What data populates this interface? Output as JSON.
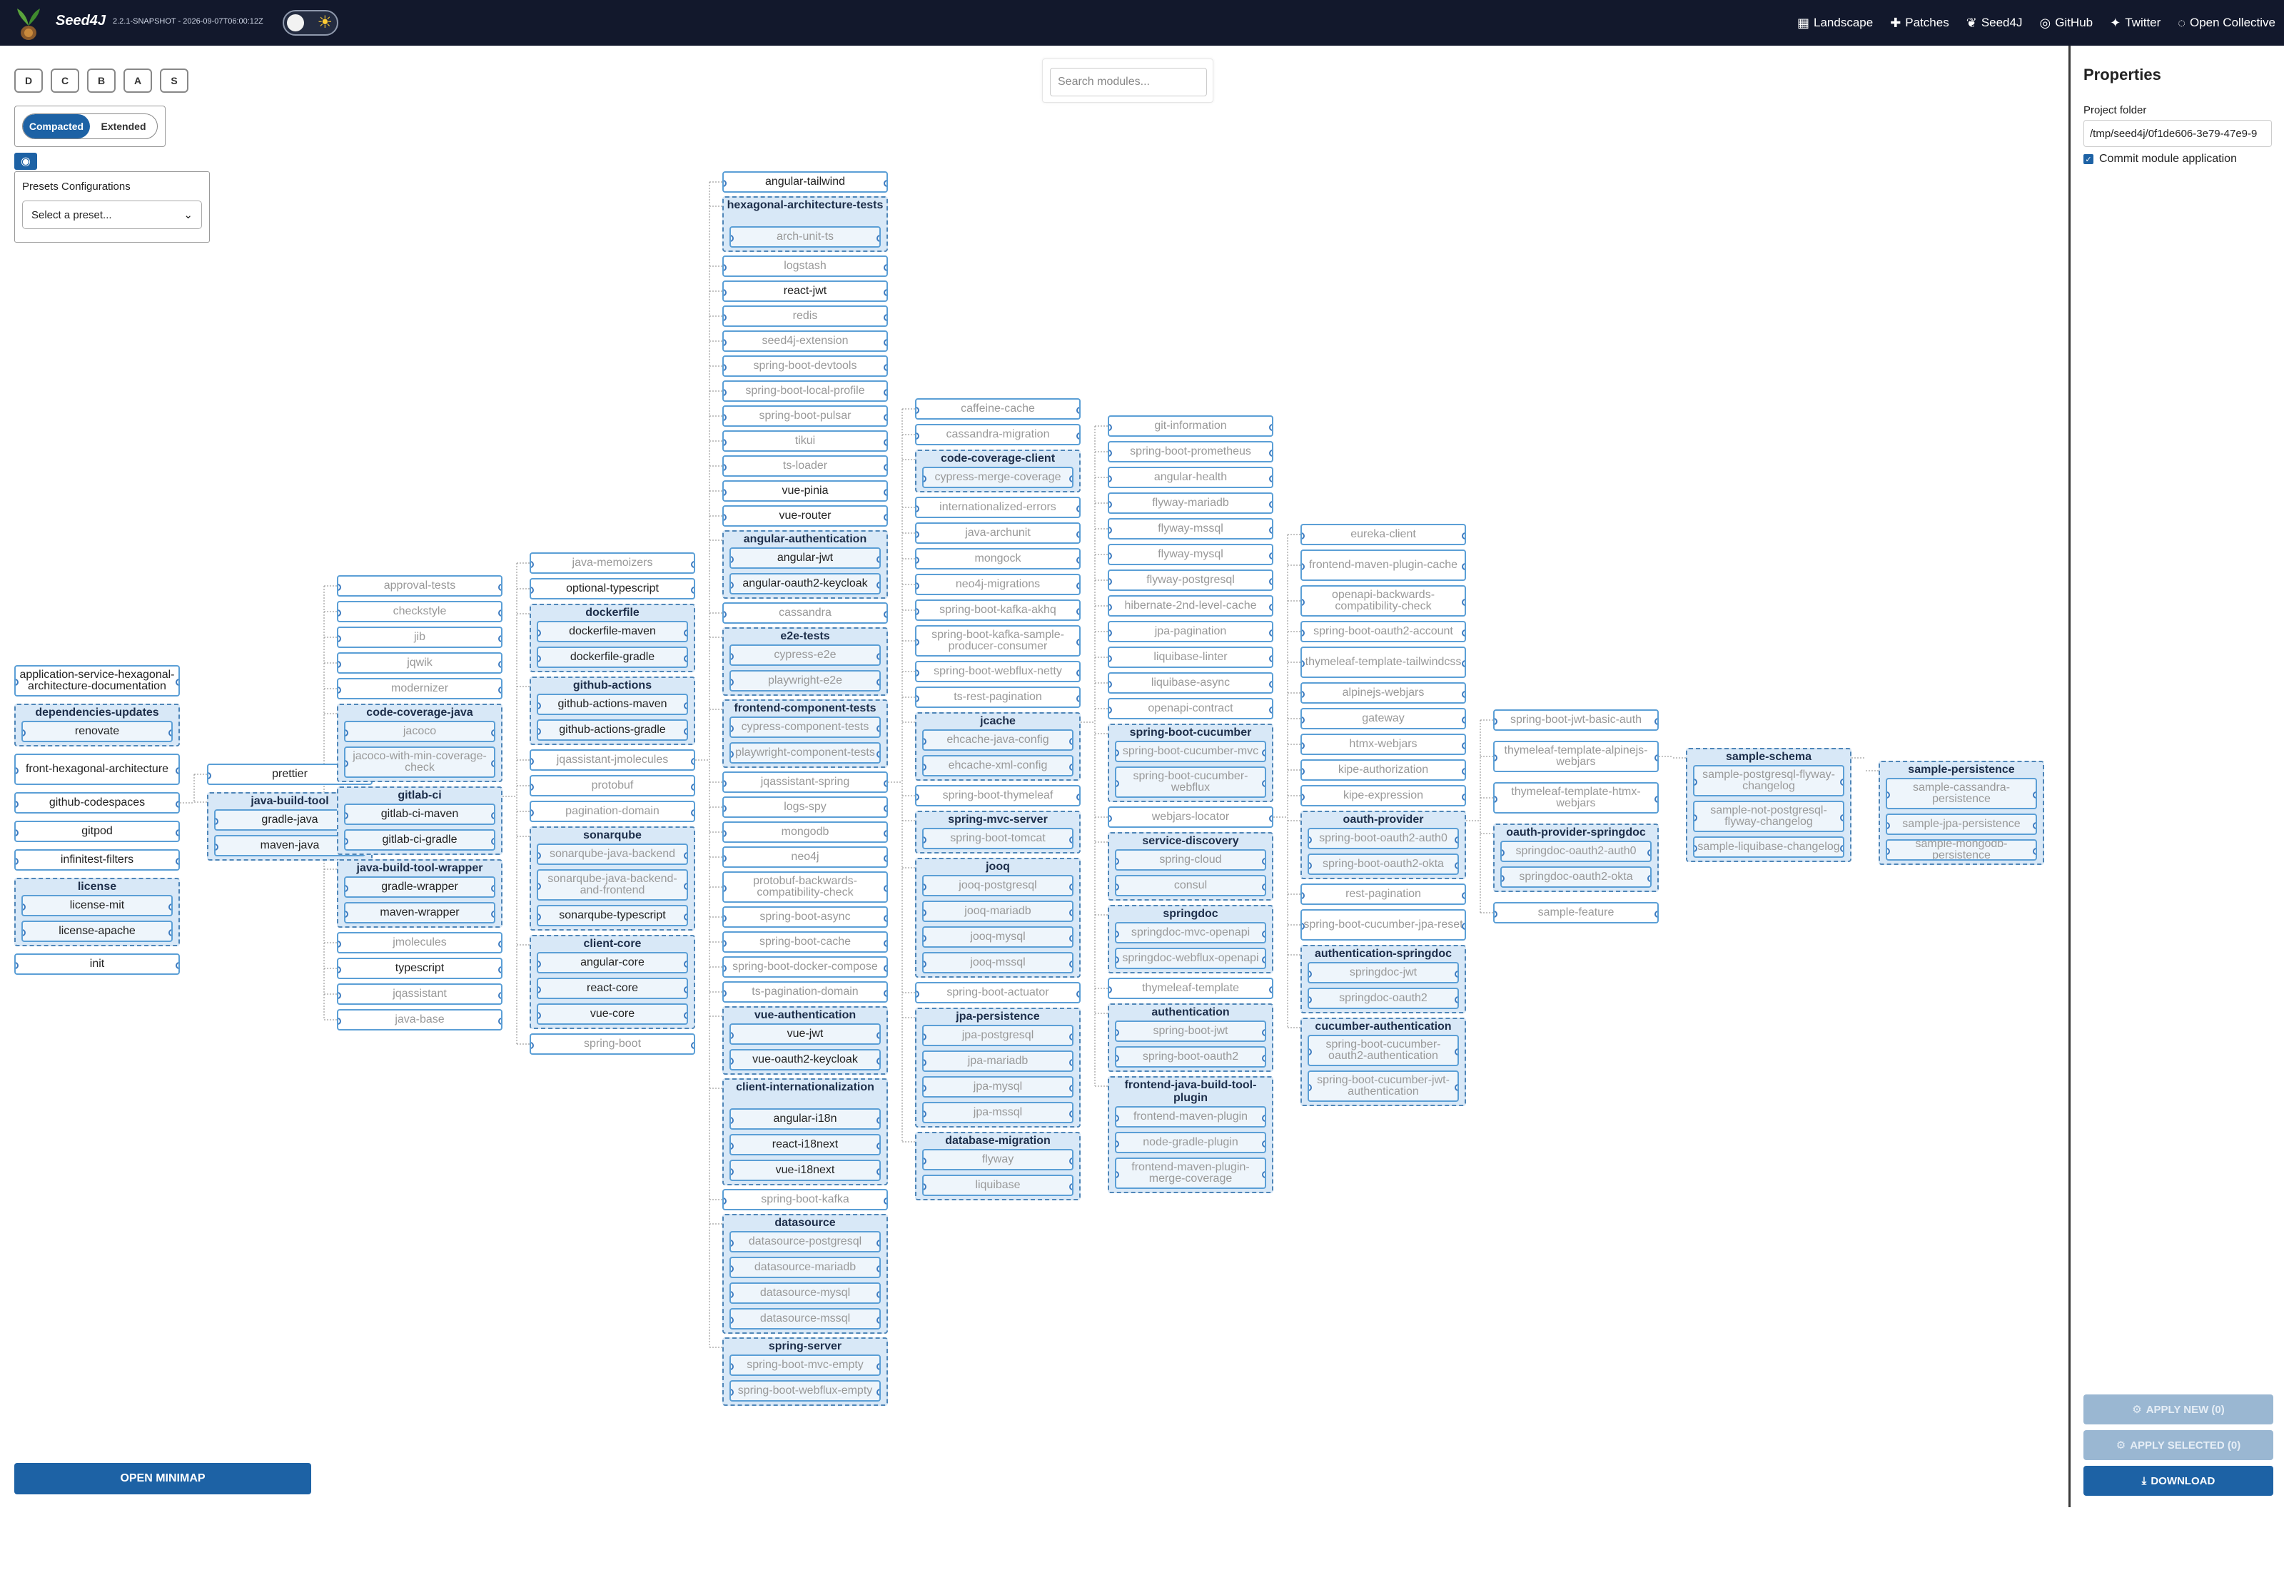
{
  "app": {
    "brand": "Seed4J",
    "version": "2.2.1-SNAPSHOT - 2026-09-07T06:00:12Z"
  },
  "nav": [
    {
      "label": "Landscape",
      "icon": "map-icon"
    },
    {
      "label": "Patches",
      "icon": "puzzle-icon"
    },
    {
      "label": "Seed4J",
      "icon": "seed-icon"
    },
    {
      "label": "GitHub",
      "icon": "github-icon"
    },
    {
      "label": "Twitter",
      "icon": "twitter-icon"
    },
    {
      "label": "Open Collective",
      "icon": "opencollective-icon"
    }
  ],
  "toolbar": {
    "letters": [
      "D",
      "C",
      "B",
      "A",
      "S"
    ],
    "mode_compacted": "Compacted",
    "mode_extended": "Extended",
    "presets_title": "Presets Configurations",
    "preset_placeholder": "Select a preset...",
    "search_placeholder": "Search modules...",
    "minimap": "OPEN MINIMAP"
  },
  "properties": {
    "title": "Properties",
    "folder_label": "Project folder",
    "folder_value": "/tmp/seed4j/0f1de606-3e79-47e9-9",
    "commit_label": "Commit module application",
    "apply_new": "APPLY NEW (0)",
    "apply_selected": "APPLY SELECTED (0)",
    "download": "DOWNLOAD"
  },
  "graph": {
    "columns": [
      {
        "items": [
          {
            "label": "application-service-hexagonal-architecture-documentation",
            "sel": true
          },
          {
            "group": "dependencies-updates",
            "items": [
              {
                "label": "renovate",
                "sel": true
              }
            ]
          },
          {
            "label": "front-hexagonal-architecture",
            "sel": true
          },
          {
            "label": "github-codespaces",
            "sel": true
          },
          {
            "label": "gitpod",
            "sel": true
          },
          {
            "label": "infinitest-filters",
            "sel": true
          },
          {
            "group": "license",
            "items": [
              {
                "label": "license-mit",
                "sel": true
              },
              {
                "label": "license-apache",
                "sel": true
              }
            ]
          },
          {
            "label": "init",
            "sel": true
          }
        ]
      },
      {
        "items": [
          {
            "label": "prettier",
            "sel": true
          },
          {
            "group": "java-build-tool",
            "items": [
              {
                "label": "gradle-java",
                "sel": true
              },
              {
                "label": "maven-java",
                "sel": true
              }
            ]
          }
        ]
      },
      {
        "items": [
          {
            "label": "approval-tests"
          },
          {
            "label": "checkstyle"
          },
          {
            "label": "jib"
          },
          {
            "label": "jqwik"
          },
          {
            "label": "modernizer"
          },
          {
            "group": "code-coverage-java",
            "items": [
              {
                "label": "jacoco"
              },
              {
                "label": "jacoco-with-min-coverage-check"
              }
            ]
          },
          {
            "group": "gitlab-ci",
            "items": [
              {
                "label": "gitlab-ci-maven",
                "sel": true
              },
              {
                "label": "gitlab-ci-gradle",
                "sel": true
              }
            ]
          },
          {
            "group": "java-build-tool-wrapper",
            "items": [
              {
                "label": "gradle-wrapper",
                "sel": true
              },
              {
                "label": "maven-wrapper",
                "sel": true
              }
            ]
          },
          {
            "label": "jmolecules"
          },
          {
            "label": "typescript",
            "sel": true
          },
          {
            "label": "jqassistant"
          },
          {
            "label": "java-base"
          }
        ]
      },
      {
        "items": [
          {
            "label": "java-memoizers"
          },
          {
            "label": "optional-typescript",
            "sel": true
          },
          {
            "group": "dockerfile",
            "items": [
              {
                "label": "dockerfile-maven",
                "sel": true
              },
              {
                "label": "dockerfile-gradle",
                "sel": true
              }
            ]
          },
          {
            "group": "github-actions",
            "items": [
              {
                "label": "github-actions-maven",
                "sel": true
              },
              {
                "label": "github-actions-gradle",
                "sel": true
              }
            ]
          },
          {
            "label": "jqassistant-jmolecules"
          },
          {
            "label": "protobuf"
          },
          {
            "label": "pagination-domain"
          },
          {
            "group": "sonarqube",
            "items": [
              {
                "label": "sonarqube-java-backend"
              },
              {
                "label": "sonarqube-java-backend-and-frontend"
              },
              {
                "label": "sonarqube-typescript",
                "sel": true
              }
            ]
          },
          {
            "group": "client-core",
            "items": [
              {
                "label": "angular-core",
                "sel": true
              },
              {
                "label": "react-core",
                "sel": true
              },
              {
                "label": "vue-core",
                "sel": true
              }
            ]
          },
          {
            "label": "spring-boot"
          }
        ]
      },
      {
        "items": [
          {
            "label": "angular-tailwind",
            "sel": true
          },
          {
            "group": "hexagonal-architecture-tests",
            "items": [
              {
                "label": "arch-unit-ts"
              }
            ]
          },
          {
            "label": "logstash"
          },
          {
            "label": "react-jwt",
            "sel": true
          },
          {
            "label": "redis"
          },
          {
            "label": "seed4j-extension"
          },
          {
            "label": "spring-boot-devtools"
          },
          {
            "label": "spring-boot-local-profile"
          },
          {
            "label": "spring-boot-pulsar"
          },
          {
            "label": "tikui"
          },
          {
            "label": "ts-loader"
          },
          {
            "label": "vue-pinia",
            "sel": true
          },
          {
            "label": "vue-router",
            "sel": true
          },
          {
            "group": "angular-authentication",
            "items": [
              {
                "label": "angular-jwt",
                "sel": true
              },
              {
                "label": "angular-oauth2-keycloak",
                "sel": true
              }
            ]
          },
          {
            "label": "cassandra"
          },
          {
            "group": "e2e-tests",
            "items": [
              {
                "label": "cypress-e2e"
              },
              {
                "label": "playwright-e2e"
              }
            ]
          },
          {
            "group": "frontend-component-tests",
            "items": [
              {
                "label": "cypress-component-tests"
              },
              {
                "label": "playwright-component-tests"
              }
            ]
          },
          {
            "label": "jqassistant-spring"
          },
          {
            "label": "logs-spy"
          },
          {
            "label": "mongodb"
          },
          {
            "label": "neo4j"
          },
          {
            "label": "protobuf-backwards-compatibility-check"
          },
          {
            "label": "spring-boot-async"
          },
          {
            "label": "spring-boot-cache"
          },
          {
            "label": "spring-boot-docker-compose"
          },
          {
            "label": "ts-pagination-domain"
          },
          {
            "group": "vue-authentication",
            "items": [
              {
                "label": "vue-jwt",
                "sel": true
              },
              {
                "label": "vue-oauth2-keycloak",
                "sel": true
              }
            ]
          },
          {
            "group": "client-internationalization",
            "items": [
              {
                "label": "angular-i18n",
                "sel": true
              },
              {
                "label": "react-i18next",
                "sel": true
              },
              {
                "label": "vue-i18next",
                "sel": true
              }
            ]
          },
          {
            "label": "spring-boot-kafka"
          },
          {
            "group": "datasource",
            "items": [
              {
                "label": "datasource-postgresql"
              },
              {
                "label": "datasource-mariadb"
              },
              {
                "label": "datasource-mysql"
              },
              {
                "label": "datasource-mssql"
              }
            ]
          },
          {
            "group": "spring-server",
            "items": [
              {
                "label": "spring-boot-mvc-empty"
              },
              {
                "label": "spring-boot-webflux-empty"
              }
            ]
          }
        ]
      },
      {
        "items": [
          {
            "label": "caffeine-cache"
          },
          {
            "label": "cassandra-migration"
          },
          {
            "group": "code-coverage-client",
            "items": [
              {
                "label": "cypress-merge-coverage"
              }
            ]
          },
          {
            "label": "internationalized-errors"
          },
          {
            "label": "java-archunit"
          },
          {
            "label": "mongock"
          },
          {
            "label": "neo4j-migrations"
          },
          {
            "label": "spring-boot-kafka-akhq"
          },
          {
            "label": "spring-boot-kafka-sample-producer-consumer"
          },
          {
            "label": "spring-boot-webflux-netty"
          },
          {
            "label": "ts-rest-pagination"
          },
          {
            "group": "jcache",
            "items": [
              {
                "label": "ehcache-java-config"
              },
              {
                "label": "ehcache-xml-config"
              }
            ]
          },
          {
            "label": "spring-boot-thymeleaf"
          },
          {
            "group": "spring-mvc-server",
            "items": [
              {
                "label": "spring-boot-tomcat"
              }
            ]
          },
          {
            "group": "jooq",
            "items": [
              {
                "label": "jooq-postgresql"
              },
              {
                "label": "jooq-mariadb"
              },
              {
                "label": "jooq-mysql"
              },
              {
                "label": "jooq-mssql"
              }
            ]
          },
          {
            "label": "spring-boot-actuator"
          },
          {
            "group": "jpa-persistence",
            "items": [
              {
                "label": "jpa-postgresql"
              },
              {
                "label": "jpa-mariadb"
              },
              {
                "label": "jpa-mysql"
              },
              {
                "label": "jpa-mssql"
              }
            ]
          },
          {
            "group": "database-migration",
            "items": [
              {
                "label": "flyway"
              },
              {
                "label": "liquibase"
              }
            ]
          }
        ]
      },
      {
        "items": [
          {
            "label": "git-information"
          },
          {
            "label": "spring-boot-prometheus"
          },
          {
            "label": "angular-health"
          },
          {
            "label": "flyway-mariadb"
          },
          {
            "label": "flyway-mssql"
          },
          {
            "label": "flyway-mysql"
          },
          {
            "label": "flyway-postgresql"
          },
          {
            "label": "hibernate-2nd-level-cache"
          },
          {
            "label": "jpa-pagination"
          },
          {
            "label": "liquibase-linter"
          },
          {
            "label": "liquibase-async"
          },
          {
            "label": "openapi-contract"
          },
          {
            "group": "spring-boot-cucumber",
            "items": [
              {
                "label": "spring-boot-cucumber-mvc"
              },
              {
                "label": "spring-boot-cucumber-webflux"
              }
            ]
          },
          {
            "label": "webjars-locator"
          },
          {
            "group": "service-discovery",
            "items": [
              {
                "label": "spring-cloud"
              },
              {
                "label": "consul"
              }
            ]
          },
          {
            "group": "springdoc",
            "items": [
              {
                "label": "springdoc-mvc-openapi"
              },
              {
                "label": "springdoc-webflux-openapi"
              }
            ]
          },
          {
            "label": "thymeleaf-template"
          },
          {
            "group": "authentication",
            "items": [
              {
                "label": "spring-boot-jwt"
              },
              {
                "label": "spring-boot-oauth2"
              }
            ]
          },
          {
            "group": "frontend-java-build-tool-plugin",
            "items": [
              {
                "label": "frontend-maven-plugin"
              },
              {
                "label": "node-gradle-plugin"
              },
              {
                "label": "frontend-maven-plugin-merge-coverage"
              }
            ]
          }
        ]
      },
      {
        "items": [
          {
            "label": "eureka-client"
          },
          {
            "label": "frontend-maven-plugin-cache"
          },
          {
            "label": "openapi-backwards-compatibility-check"
          },
          {
            "label": "spring-boot-oauth2-account"
          },
          {
            "label": "thymeleaf-template-tailwindcss"
          },
          {
            "label": "alpinejs-webjars"
          },
          {
            "label": "gateway"
          },
          {
            "label": "htmx-webjars"
          },
          {
            "label": "kipe-authorization"
          },
          {
            "label": "kipe-expression"
          },
          {
            "group": "oauth-provider",
            "items": [
              {
                "label": "spring-boot-oauth2-auth0"
              },
              {
                "label": "spring-boot-oauth2-okta"
              }
            ]
          },
          {
            "label": "rest-pagination"
          },
          {
            "label": "spring-boot-cucumber-jpa-reset"
          },
          {
            "group": "authentication-springdoc",
            "items": [
              {
                "label": "springdoc-jwt"
              },
              {
                "label": "springdoc-oauth2"
              }
            ]
          },
          {
            "group": "cucumber-authentication",
            "items": [
              {
                "label": "spring-boot-cucumber-oauth2-authentication"
              },
              {
                "label": "spring-boot-cucumber-jwt-authentication"
              }
            ]
          }
        ]
      },
      {
        "items": [
          {
            "label": "spring-boot-jwt-basic-auth"
          },
          {
            "label": "thymeleaf-template-alpinejs-webjars"
          },
          {
            "label": "thymeleaf-template-htmx-webjars"
          },
          {
            "group": "oauth-provider-springdoc",
            "items": [
              {
                "label": "springdoc-oauth2-auth0"
              },
              {
                "label": "springdoc-oauth2-okta"
              }
            ]
          },
          {
            "label": "sample-feature"
          }
        ]
      },
      {
        "items": [
          {
            "group": "sample-schema",
            "items": [
              {
                "label": "sample-postgresql-flyway-changelog"
              },
              {
                "label": "sample-not-postgresql-flyway-changelog"
              },
              {
                "label": "sample-liquibase-changelog"
              }
            ]
          }
        ]
      },
      {
        "items": [
          {
            "group": "sample-persistence",
            "items": [
              {
                "label": "sample-cassandra-persistence"
              },
              {
                "label": "sample-jpa-persistence"
              },
              {
                "label": "sample-mongodb-persistence"
              }
            ]
          }
        ]
      }
    ]
  }
}
